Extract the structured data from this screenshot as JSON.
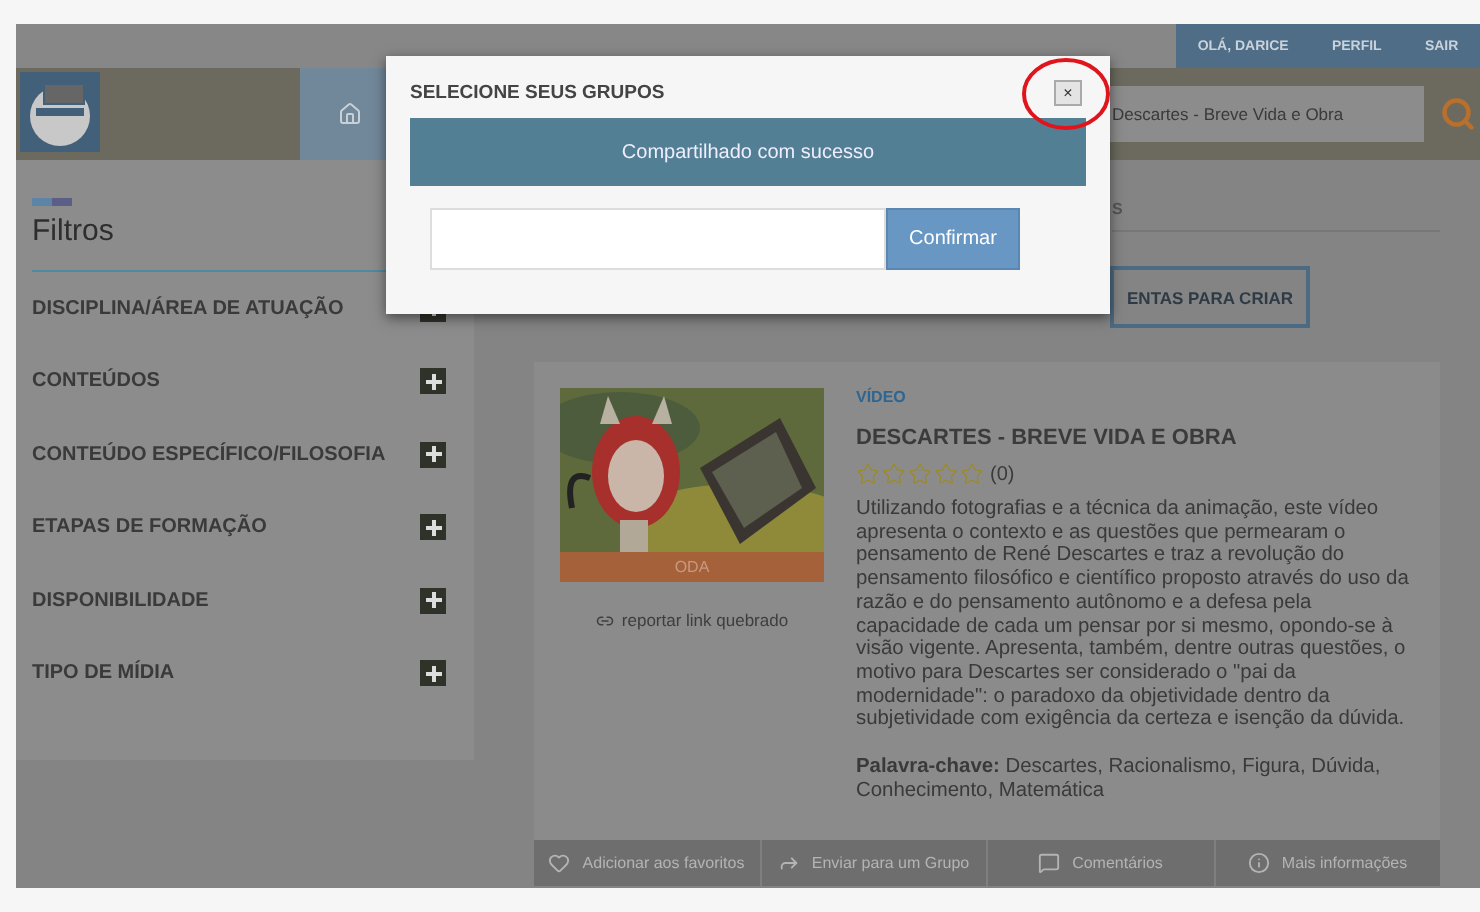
{
  "top_bar": {
    "user_links": [
      {
        "label": "OLÁ, DARICE"
      },
      {
        "label": "PERFIL"
      },
      {
        "label": "SAIR"
      }
    ]
  },
  "header": {
    "search": {
      "value": "Descartes - Breve Vida e Obra"
    }
  },
  "sidebar": {
    "title": "Filtros",
    "filters": [
      {
        "label": "DISCIPLINA/ÁREA DE ATUAÇÃO"
      },
      {
        "label": "CONTEÚDOS"
      },
      {
        "label": "CONTEÚDO ESPECÍFICO/FILOSOFIA"
      },
      {
        "label": "ETAPAS DE FORMAÇÃO"
      },
      {
        "label": "DISPONIBILIDADE"
      },
      {
        "label": "TIPO DE MÍDIA"
      }
    ]
  },
  "content": {
    "tab_partial": "S",
    "create_button": "ENTAS PARA CRIAR"
  },
  "card": {
    "badge": "ODA",
    "report_link": "reportar link quebrado",
    "type_label": "VÍDEO",
    "title": "DESCARTES - BREVE VIDA E OBRA",
    "stars": 0,
    "rating_count": "(0)",
    "description": "Utilizando fotografias e a técnica da animação, este vídeo apresenta o contexto e as questões que permearam o pensamento de René Descartes e traz a revolução do pensamento filosófico e científico proposto através do uso da razão e do pensamento autônomo e a defesa pela capacidade de cada um pensar por si mesmo, opondo-se à visão vigente. Apresenta, também, dentre outras questões, o motivo para Descartes ser considerado o \"pai da modernidade\": o paradoxo da objetividade dentro da subjetividade com exigência da certeza e isenção da dúvida.",
    "keywords": "**Palavra-chave:** Descartes, Racionalismo, Figura, Dúvida, Conhecimento, Matemática",
    "actions": [
      {
        "kind": "favorite",
        "label": "Adicionar aos favoritos"
      },
      {
        "kind": "share",
        "label": "Enviar para um Grupo"
      },
      {
        "kind": "comments",
        "label": "Comentários"
      },
      {
        "kind": "info",
        "label": "Mais informações"
      }
    ]
  },
  "modal": {
    "title": "SELECIONE SEUS GRUPOS",
    "close": "×",
    "message": "Compartilhado com sucesso",
    "confirm_button": "Confirmar"
  }
}
